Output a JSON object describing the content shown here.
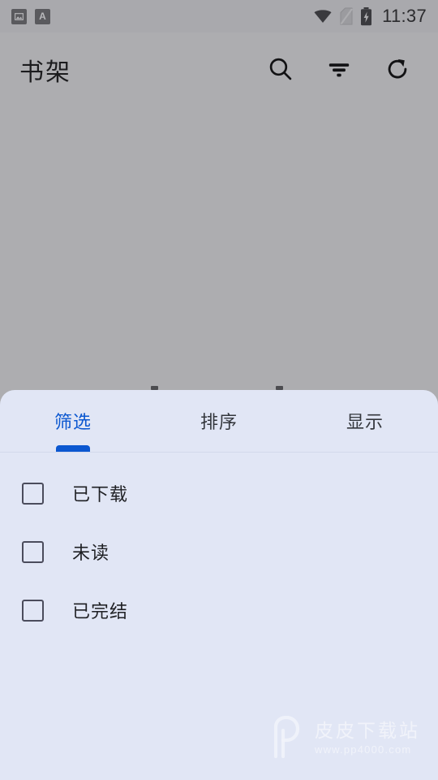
{
  "status_bar": {
    "time": "11:37",
    "left_icons": [
      {
        "name": "image-notification-icon",
        "glyph": "image"
      },
      {
        "name": "font-notification-icon",
        "glyph": "A"
      }
    ],
    "right_icons": [
      {
        "name": "wifi-icon"
      },
      {
        "name": "no-sim-icon"
      },
      {
        "name": "battery-charging-icon"
      }
    ]
  },
  "app_bar": {
    "title": "书架",
    "actions": [
      {
        "name": "search-button",
        "icon": "search-icon"
      },
      {
        "name": "filter-button",
        "icon": "filter-icon"
      },
      {
        "name": "refresh-button",
        "icon": "refresh-icon"
      }
    ]
  },
  "bottom_sheet": {
    "tabs": [
      {
        "label": "筛选",
        "active": true
      },
      {
        "label": "排序",
        "active": false
      },
      {
        "label": "显示",
        "active": false
      }
    ],
    "filters": [
      {
        "label": "已下载",
        "checked": false
      },
      {
        "label": "未读",
        "checked": false
      },
      {
        "label": "已完结",
        "checked": false
      }
    ]
  },
  "watermark": {
    "title": "皮皮下载站",
    "url": "www.pp4000.com"
  },
  "colors": {
    "scrim": "#adadb0",
    "sheet_bg": "#e1e6f5",
    "accent_blue": "#0b57d0",
    "text_primary": "#1f2024",
    "checkbox_border": "#4b4c5c"
  }
}
